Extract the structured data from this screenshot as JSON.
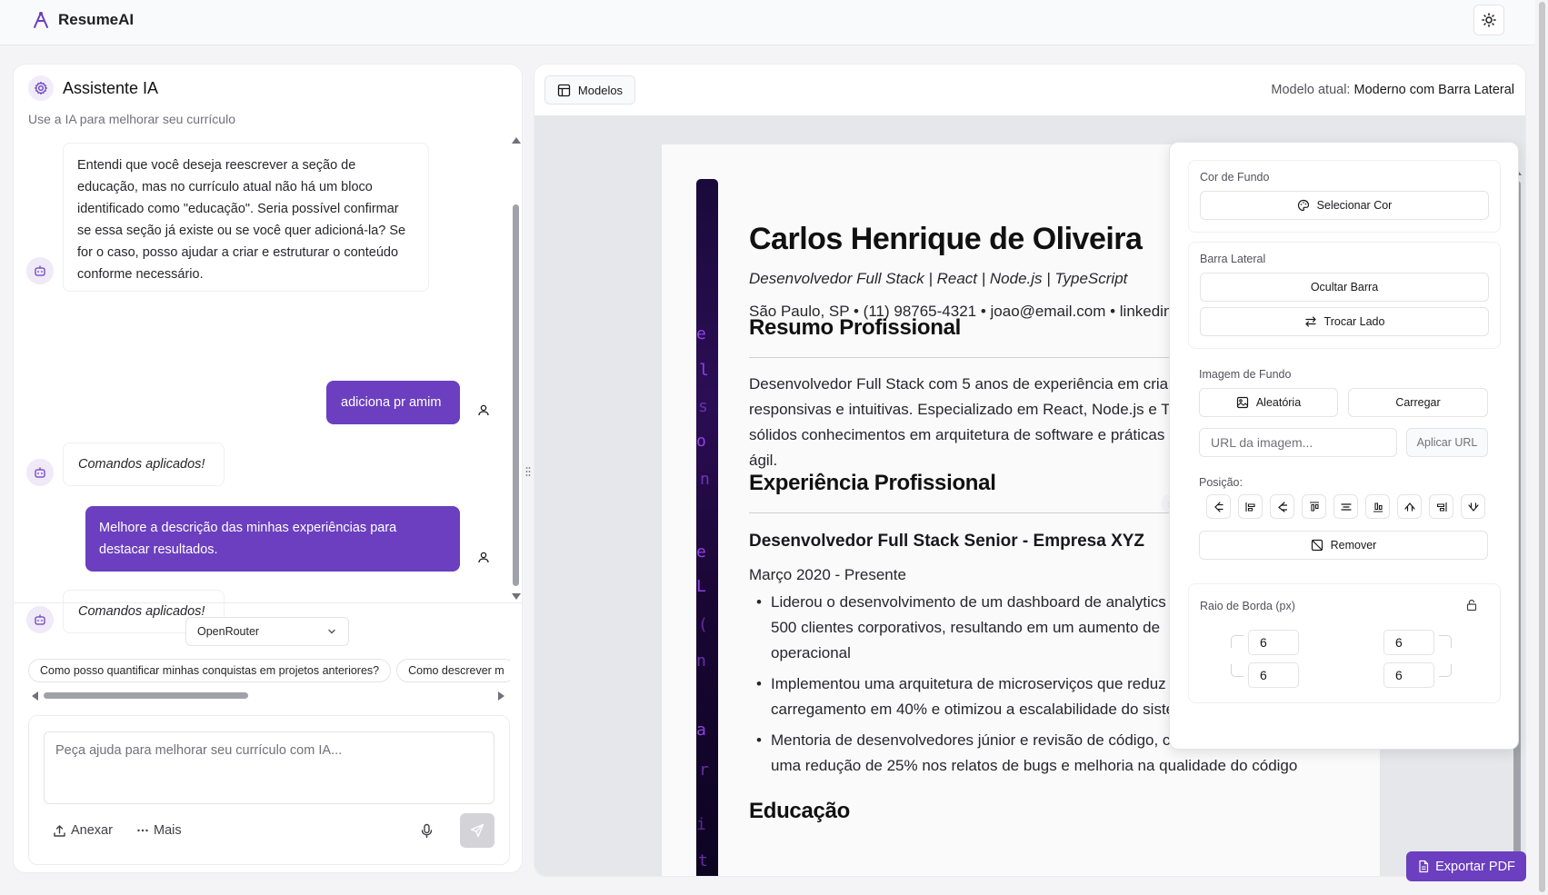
{
  "app": {
    "name": "ResumeAI"
  },
  "assistant": {
    "title": "Assistente IA",
    "subtitle": "Use a IA para melhorar seu currículo",
    "messages": [
      {
        "role": "bot",
        "text": "Entendi que você deseja reescrever a seção de educação, mas no currículo atual não há um bloco identificado como \"educação\". Seria possível confirmar se essa seção já existe ou se você quer adicioná-la? Se for o caso, posso ajudar a criar e estruturar o conteúdo conforme necessário.",
        "lines": [
          "Entendi que você deseja reescrever a seção de",
          "educação, mas no currículo atual não há um bloco",
          "identificado como \"educação\". Seria possível confirmar",
          "se essa seção já existe ou se você quer adicioná-la? Se",
          "for o caso, posso ajudar a criar e estruturar o conteúdo",
          "conforme necessário."
        ]
      },
      {
        "role": "user",
        "text": "adiciona pr amim"
      },
      {
        "role": "bot",
        "text": "Comandos aplicados!"
      },
      {
        "role": "user",
        "text": "Melhore a descrição das minhas experiências para destacar resultados.",
        "lines": [
          "Melhore a descrição das minhas experiências para",
          "destacar resultados."
        ]
      },
      {
        "role": "bot",
        "text": "Comandos aplicados!"
      }
    ],
    "model_select": "OpenRouter",
    "suggestions": [
      "Como posso quantificar minhas conquistas em projetos anteriores?",
      "Como descrever m"
    ],
    "composer": {
      "placeholder": "Peça ajuda para melhorar seu currículo com IA...",
      "attach_label": "Anexar",
      "more_label": "Mais"
    }
  },
  "preview": {
    "models_button": "Modelos",
    "current_model_label": "Modelo atual:",
    "current_model_value": "Moderno com Barra Lateral",
    "export_label": "Exportar PDF"
  },
  "resume": {
    "name": "Carlos Henrique de Oliveira",
    "role": "Desenvolvedor Full Stack | React | Node.js | TypeScript",
    "contact": "São Paulo, SP • (11) 98765-4321 • joao@email.com • linkedin",
    "summary_heading": "Resumo Profissional",
    "summary_lines": [
      "Desenvolvedor Full Stack com 5 anos de experiência em criar",
      "responsivas e intuitivas. Especializado em React, Node.js e Ty",
      "sólidos conhecimentos em arquitetura de software e práticas",
      "ágil."
    ],
    "experience_heading": "Experiência Profissional",
    "job_title": "Desenvolvedor Full Stack Senior - Empresa XYZ",
    "job_period": "Março 2020 - Presente",
    "bullets": [
      [
        "Liderou o desenvolvimento de um dashboard de analytics",
        "500 clientes corporativos, resultando em um aumento de",
        "operacional"
      ],
      [
        "Implementou uma arquitetura de microserviços que reduz",
        "carregamento em 40% e otimizou a escalabilidade do sistema"
      ],
      [
        "Mentoria de desenvolvedores júnior e revisão de código, contribuindo para",
        "uma redução de 25% nos relatos de bugs e melhoria na qualidade do código"
      ]
    ],
    "education_heading": "Educação"
  },
  "style_panel": {
    "bg_color_label": "Cor de Fundo",
    "select_color": "Selecionar Cor",
    "sidebar_label": "Barra Lateral",
    "hide_bar": "Ocultar Barra",
    "swap_side": "Trocar Lado",
    "bg_image_label": "Imagem de Fundo",
    "random": "Aleatória",
    "upload": "Carregar",
    "url_placeholder": "URL da imagem...",
    "apply_url": "Aplicar URL",
    "position_label": "Posição:",
    "remove": "Remover",
    "border_radius_label": "Raio de Borda (px)",
    "radius": {
      "top_left": "6",
      "top_right": "6",
      "bottom_left": "6",
      "bottom_right": "6"
    }
  },
  "colors": {
    "accent": "#6b3fbf",
    "sidebar_bar": "#1a0a3a",
    "code_glyph": "#a54bff"
  }
}
